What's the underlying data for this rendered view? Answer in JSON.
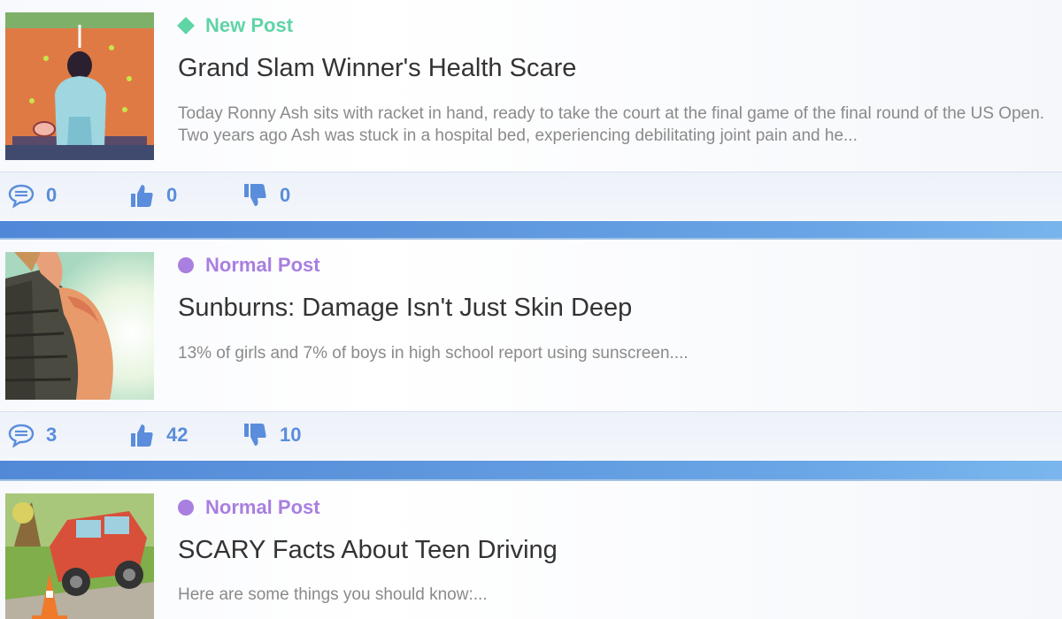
{
  "colors": {
    "new_post": "#5fd4a6",
    "normal_post": "#a97fe0",
    "stat_icons": "#5a8ddb",
    "title": "#333333",
    "excerpt": "#8a8a8a",
    "background": "#5d95dd"
  },
  "posts": [
    {
      "tag": "New Post",
      "tag_kind": "new",
      "title": "Grand Slam Winner's Health Scare",
      "excerpt": "Today Ronny Ash sits with racket in hand, ready to take the court at the final game of the final round of the US Open. Two years ago Ash was stuck in a hospital bed, experiencing debilitating joint pain and he...",
      "comments": "0",
      "likes": "0",
      "dislikes": "0",
      "thumbnail_icon": "tennis-player-thumbnail"
    },
    {
      "tag": "Normal Post",
      "tag_kind": "normal",
      "title": "Sunburns: Damage Isn't Just Skin Deep",
      "excerpt": "13% of girls and 7% of boys in high school report using sunscreen....",
      "comments": "3",
      "likes": "42",
      "dislikes": "10",
      "thumbnail_icon": "sunburned-shoulder-thumbnail"
    },
    {
      "tag": "Normal Post",
      "tag_kind": "normal",
      "title": "SCARY Facts About Teen Driving",
      "excerpt": "Here are some things you should know:...",
      "comments": "",
      "likes": "",
      "dislikes": "",
      "thumbnail_icon": "crashed-car-thumbnail"
    }
  ]
}
